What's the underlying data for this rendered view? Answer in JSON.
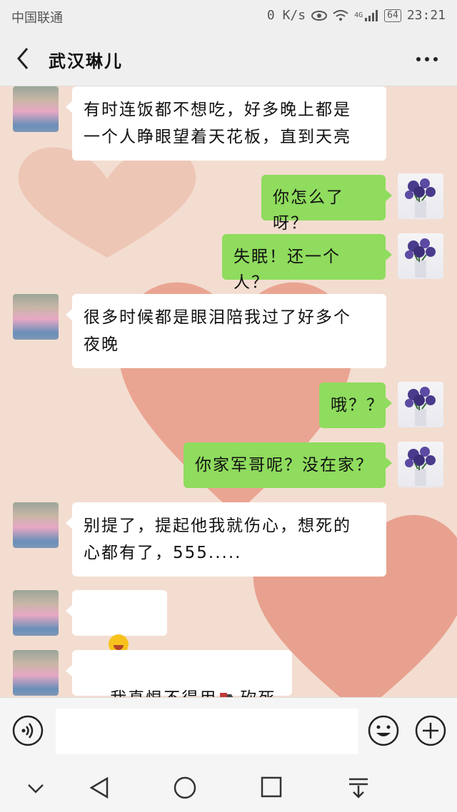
{
  "status_bar": {
    "carrier": "中国联通",
    "net_speed": "0 K/s",
    "network": "4G",
    "battery": "64",
    "time": "23:21"
  },
  "header": {
    "title": "武汉琳儿",
    "back_icon": "back-arrow-icon",
    "more_icon": "more-dots-icon"
  },
  "messages": [
    {
      "side": "left",
      "text": "有时连饭都不想吃，好多晚上都是\n一个人睁眼望着天花板，直到天亮"
    },
    {
      "side": "right",
      "text": "你怎么了呀？"
    },
    {
      "side": "right",
      "text": "失眠！还一个人？"
    },
    {
      "side": "left",
      "text": "很多时候都是眼泪陪我过了好多个\n夜晚"
    },
    {
      "side": "right",
      "text": "哦？？"
    },
    {
      "side": "right",
      "text": "你家军哥呢？没在家？"
    },
    {
      "side": "left",
      "text": "别提了，提起他我就伤心，想死的\n心都有了，555....."
    },
    {
      "side": "left",
      "emoji_count": 3,
      "emoji": "crying-face-icon"
    },
    {
      "side": "left",
      "text_before": "我真恨不得用",
      "text_after": "砍死他",
      "inline_icon": "knife-icon"
    }
  ],
  "input_bar": {
    "voice_icon": "voice-icon",
    "input_value": "",
    "emoji_icon": "smiley-icon",
    "plus_icon": "plus-icon"
  },
  "nav_bar": {
    "icons": [
      "collapse-down-icon",
      "back-triangle-icon",
      "home-circle-icon",
      "recents-square-icon",
      "notification-pull-icon"
    ]
  },
  "colors": {
    "sent_bubble": "#8fdc5e",
    "received_bubble": "#ffffff",
    "chat_bg": "#f3ddd0",
    "heart": "#e79a87"
  }
}
